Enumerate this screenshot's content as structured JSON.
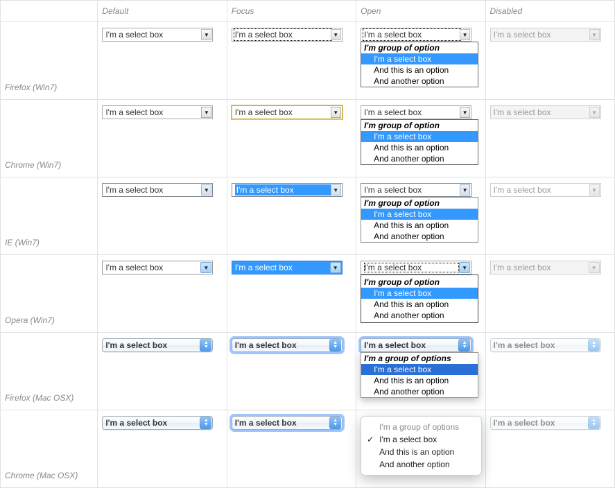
{
  "columns": [
    "Default",
    "Focus",
    "Open",
    "Disabled"
  ],
  "rows": [
    {
      "label": "Firefox (Win7)"
    },
    {
      "label": "Chrome (Win7)"
    },
    {
      "label": "IE (Win7)"
    },
    {
      "label": "Opera (Win7)"
    },
    {
      "label": "Firefox (Mac OSX)"
    },
    {
      "label": "Chrome (Mac OSX)"
    }
  ],
  "select_text": "I'm a select box",
  "optgroup_win": "I'm group of option",
  "optgroup_mac": "I'm a group of options",
  "opt_selected": "I'm a select box",
  "opt2": "And this is an option",
  "opt3": "And another option"
}
